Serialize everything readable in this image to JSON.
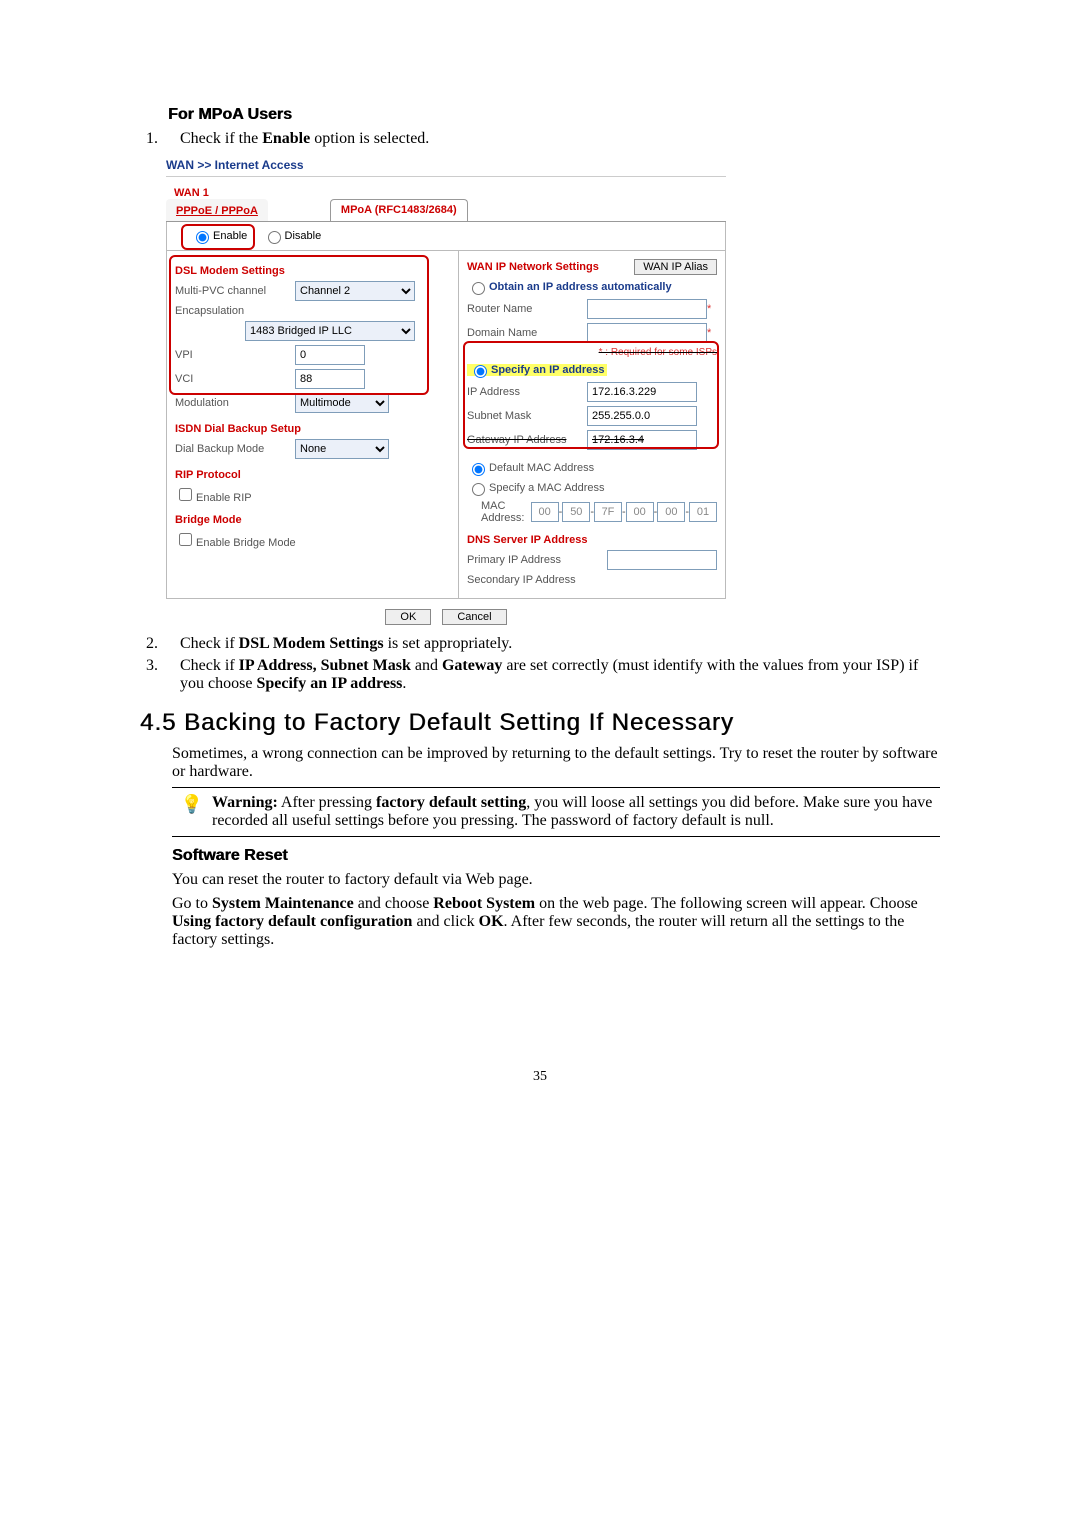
{
  "heading_mpoa": "For MPoA Users",
  "step1": "Check if the Enable option is selected.",
  "breadcrumb": "WAN >> Internet Access",
  "screenshot": {
    "wan1": "WAN 1",
    "tab_pppoe": "PPPoE / PPPoA",
    "tab_mpoa": "MPoA (RFC1483/2684)",
    "enable": "Enable",
    "disable": "Disable",
    "dsl_title": "DSL Modem Settings",
    "multi_pvc": "Multi-PVC channel",
    "multi_pvc_val": "Channel 2",
    "encapsulation": "Encapsulation",
    "encap_val": "1483 Bridged IP LLC",
    "vpi": "VPI",
    "vpi_val": "0",
    "vci": "VCI",
    "vci_val": "88",
    "modulation": "Modulation",
    "modulation_val": "Multimode",
    "isdn_title": "ISDN Dial Backup Setup",
    "dial_backup": "Dial Backup Mode",
    "dial_backup_val": "None",
    "rip_title": "RIP Protocol",
    "enable_rip": "Enable RIP",
    "bridge_title": "Bridge Mode",
    "enable_bridge": "Enable Bridge Mode",
    "wan_ip_net": "WAN IP Network Settings",
    "wan_ip_alias": "WAN IP Alias",
    "obtain_auto": "Obtain an IP address automatically",
    "router_name": "Router Name",
    "domain_name": "Domain Name",
    "req_note": "* : Required for some ISPs",
    "specify_ip": "Specify an IP address",
    "ip_address": "IP Address",
    "ip_val": "172.16.3.229",
    "subnet": "Subnet Mask",
    "subnet_val": "255.255.0.0",
    "gateway": "Gateway IP Address",
    "gateway_val": "172.16.3.4",
    "default_mac": "Default MAC Address",
    "specify_mac": "Specify a MAC Address",
    "mac_label": "MAC Address:",
    "mac": [
      "00",
      "50",
      "7F",
      "00",
      "00",
      "01"
    ],
    "dns_title": "DNS Server IP Address",
    "primary_ip": "Primary IP Address",
    "secondary_ip": "Secondary IP Address",
    "ok": "OK",
    "cancel": "Cancel"
  },
  "step2": "Check if DSL Modem Settings is set appropriately.",
  "step3": "Check if IP Address, Subnet Mask and Gateway are set correctly (must identify with the values from your ISP) if you choose Specify an IP address.",
  "heading_45": "4.5 Backing to Factory Default Setting If Necessary",
  "para45_1": "Sometimes, a wrong connection can be improved by returning to the default settings. Try to reset the router by software or hardware.",
  "bulb_text": "Warning: After pressing factory default setting, you will loose all settings you did before. Make sure you have recorded all useful settings before you pressing. The password of factory default is null.",
  "heading_sw": "Software Reset",
  "para_sw1": "You can reset the router to factory default via Web page.",
  "para_sw2": "Go to System Maintenance and choose Reboot System on the web page. The following screen will appear. Choose Using factory default configuration and click OK. After few seconds, the router will return all the settings to the factory settings.",
  "page_number": "35"
}
